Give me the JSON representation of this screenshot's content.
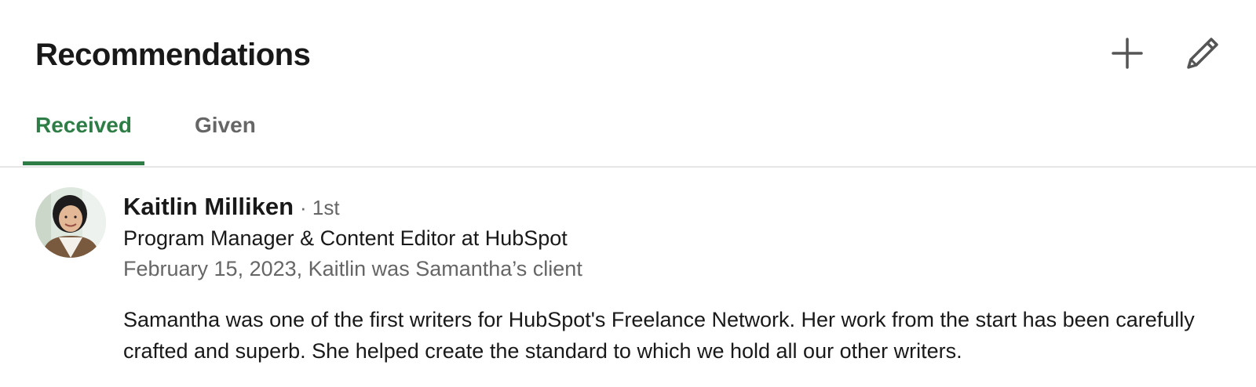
{
  "section": {
    "title": "Recommendations",
    "add_icon": "plus-icon",
    "edit_icon": "pencil-icon"
  },
  "tabs": [
    {
      "label": "Received",
      "active": true
    },
    {
      "label": "Given",
      "active": false
    }
  ],
  "colors": {
    "accent": "#2e7d46",
    "text_primary": "#191919",
    "text_secondary": "#666666",
    "divider": "#e6e6e6"
  },
  "recommendation": {
    "name": "Kaitlin Milliken",
    "degree": "· 1st",
    "headline": "Program Manager & Content Editor at HubSpot",
    "meta": "February 15, 2023, Kaitlin was Samantha’s client",
    "text": "Samantha was one of the first writers for HubSpot's Freelance Network. Her work from the start has been carefully crafted and superb. She helped create the standard to which we hold all our other writers."
  }
}
